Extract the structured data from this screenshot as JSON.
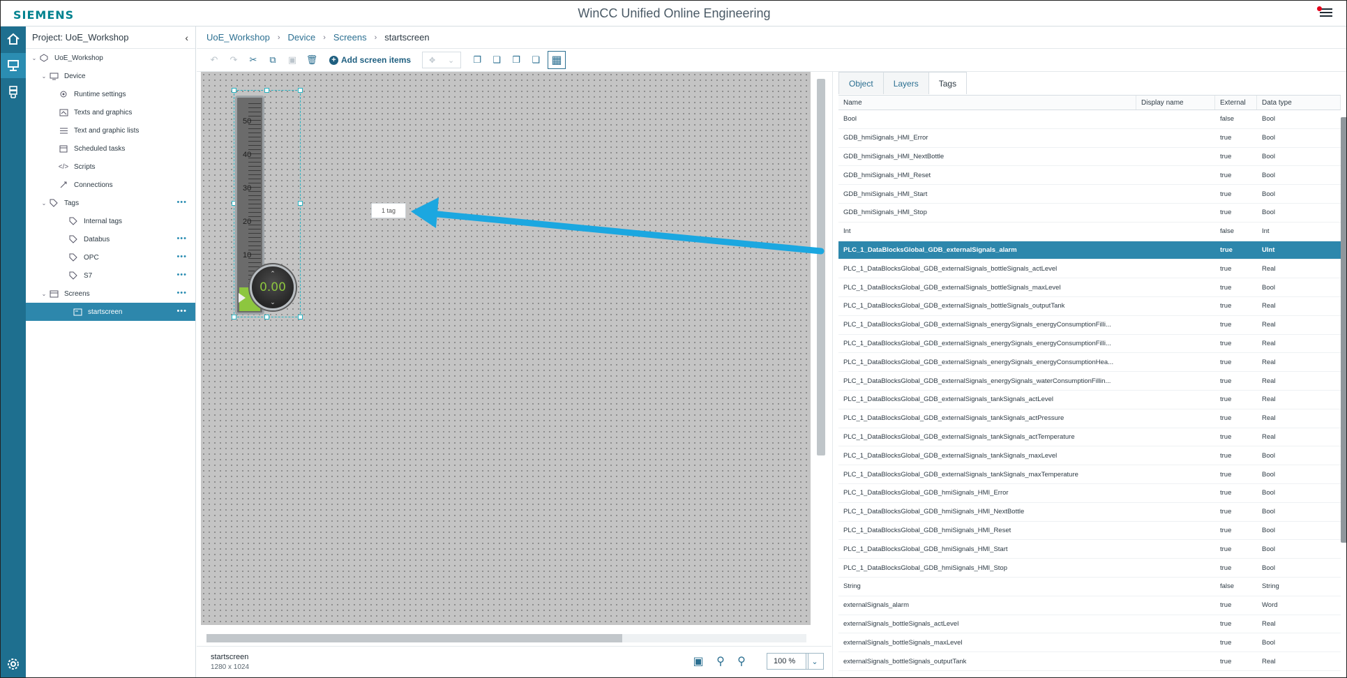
{
  "header": {
    "logo": "SIEMENS",
    "title": "WinCC Unified Online Engineering"
  },
  "activity_bar": {
    "items": [
      "home-icon",
      "screens-icon",
      "devices-icon",
      "settings-icon"
    ]
  },
  "project_tree": {
    "title": "Project: UoE_Workshop",
    "items": [
      {
        "label": "UoE_Workshop"
      },
      {
        "label": "Device"
      },
      {
        "label": "Runtime settings"
      },
      {
        "label": "Texts and graphics"
      },
      {
        "label": "Text and graphic lists"
      },
      {
        "label": "Scheduled tasks"
      },
      {
        "label": "Scripts"
      },
      {
        "label": "Connections"
      },
      {
        "label": "Tags"
      },
      {
        "label": "Internal tags"
      },
      {
        "label": "Databus"
      },
      {
        "label": "OPC"
      },
      {
        "label": "S7"
      },
      {
        "label": "Screens"
      },
      {
        "label": "startscreen"
      }
    ]
  },
  "breadcrumb": {
    "items": [
      "UoE_Workshop",
      "Device",
      "Screens",
      "startscreen"
    ]
  },
  "toolbar": {
    "add_screen_items": "Add screen items"
  },
  "canvas": {
    "gauge": {
      "scale_labels": [
        "50",
        "40",
        "30",
        "20",
        "10"
      ],
      "value": "0.00"
    },
    "tag_tooltip": "1 tag"
  },
  "status": {
    "screen_name": "startscreen",
    "screen_size": "1280 x 1024",
    "zoom": "100 %"
  },
  "right_panel": {
    "tabs": [
      "Object",
      "Layers",
      "Tags"
    ],
    "active_tab": "Tags",
    "columns": [
      "Name",
      "Display name",
      "External",
      "Data type"
    ],
    "rows": [
      [
        "Bool",
        "",
        "false",
        "Bool"
      ],
      [
        "GDB_hmiSignals_HMI_Error",
        "",
        "true",
        "Bool"
      ],
      [
        "GDB_hmiSignals_HMI_NextBottle",
        "",
        "true",
        "Bool"
      ],
      [
        "GDB_hmiSignals_HMI_Reset",
        "",
        "true",
        "Bool"
      ],
      [
        "GDB_hmiSignals_HMI_Start",
        "",
        "true",
        "Bool"
      ],
      [
        "GDB_hmiSignals_HMI_Stop",
        "",
        "true",
        "Bool"
      ],
      [
        "Int",
        "",
        "false",
        "Int"
      ],
      [
        "PLC_1_DataBlocksGlobal_GDB_externalSignals_alarm",
        "",
        "true",
        "UInt"
      ],
      [
        "PLC_1_DataBlocksGlobal_GDB_externalSignals_bottleSignals_actLevel",
        "",
        "true",
        "Real"
      ],
      [
        "PLC_1_DataBlocksGlobal_GDB_externalSignals_bottleSignals_maxLevel",
        "",
        "true",
        "Bool"
      ],
      [
        "PLC_1_DataBlocksGlobal_GDB_externalSignals_bottleSignals_outputTank",
        "",
        "true",
        "Real"
      ],
      [
        "PLC_1_DataBlocksGlobal_GDB_externalSignals_energySignals_energyConsumptionFilli...",
        "",
        "true",
        "Real"
      ],
      [
        "PLC_1_DataBlocksGlobal_GDB_externalSignals_energySignals_energyConsumptionFilli...",
        "",
        "true",
        "Real"
      ],
      [
        "PLC_1_DataBlocksGlobal_GDB_externalSignals_energySignals_energyConsumptionHea...",
        "",
        "true",
        "Real"
      ],
      [
        "PLC_1_DataBlocksGlobal_GDB_externalSignals_energySignals_waterConsumptionFillin...",
        "",
        "true",
        "Real"
      ],
      [
        "PLC_1_DataBlocksGlobal_GDB_externalSignals_tankSignals_actLevel",
        "",
        "true",
        "Real"
      ],
      [
        "PLC_1_DataBlocksGlobal_GDB_externalSignals_tankSignals_actPressure",
        "",
        "true",
        "Real"
      ],
      [
        "PLC_1_DataBlocksGlobal_GDB_externalSignals_tankSignals_actTemperature",
        "",
        "true",
        "Real"
      ],
      [
        "PLC_1_DataBlocksGlobal_GDB_externalSignals_tankSignals_maxLevel",
        "",
        "true",
        "Bool"
      ],
      [
        "PLC_1_DataBlocksGlobal_GDB_externalSignals_tankSignals_maxTemperature",
        "",
        "true",
        "Bool"
      ],
      [
        "PLC_1_DataBlocksGlobal_GDB_hmiSignals_HMI_Error",
        "",
        "true",
        "Bool"
      ],
      [
        "PLC_1_DataBlocksGlobal_GDB_hmiSignals_HMI_NextBottle",
        "",
        "true",
        "Bool"
      ],
      [
        "PLC_1_DataBlocksGlobal_GDB_hmiSignals_HMI_Reset",
        "",
        "true",
        "Bool"
      ],
      [
        "PLC_1_DataBlocksGlobal_GDB_hmiSignals_HMI_Start",
        "",
        "true",
        "Bool"
      ],
      [
        "PLC_1_DataBlocksGlobal_GDB_hmiSignals_HMI_Stop",
        "",
        "true",
        "Bool"
      ],
      [
        "String",
        "",
        "false",
        "String"
      ],
      [
        "externalSignals_alarm",
        "",
        "true",
        "Word"
      ],
      [
        "externalSignals_bottleSignals_actLevel",
        "",
        "true",
        "Real"
      ],
      [
        "externalSignals_bottleSignals_maxLevel",
        "",
        "true",
        "Bool"
      ],
      [
        "externalSignals_bottleSignals_outputTank",
        "",
        "true",
        "Real"
      ]
    ],
    "selected_row": 7
  },
  "colors": {
    "accent": "#2d87ac",
    "brand": "#00828f",
    "arrow": "#1ba7e0",
    "gauge_fill": "#8dc63f"
  }
}
